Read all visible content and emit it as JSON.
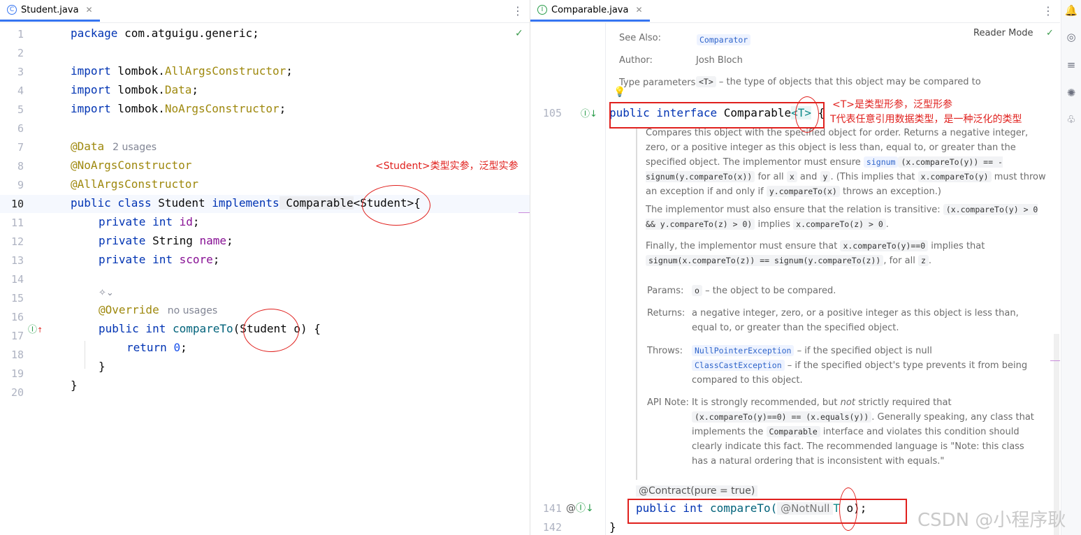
{
  "left_tab": {
    "label": "Student.java",
    "icon": "class-icon"
  },
  "right_tab": {
    "label": "Comparable.java",
    "icon": "interface-icon"
  },
  "left_gutter": [
    "1",
    "2",
    "3",
    "4",
    "5",
    "6",
    "7",
    "8",
    "9",
    "10",
    "11",
    "12",
    "13",
    "14",
    "15",
    "16",
    "17",
    "18",
    "19",
    "20"
  ],
  "left_code": {
    "l1": "package com.atguigu.generic;",
    "l3_kw": "import",
    "l3_a": " lombok.",
    "l3_b": "AllArgsConstructor",
    "l3_c": ";",
    "l4_kw": "import",
    "l4_a": " lombok.",
    "l4_b": "Data",
    "l4_c": ";",
    "l5_kw": "import",
    "l5_a": " lombok.",
    "l5_b": "NoArgsConstructor",
    "l5_c": ";",
    "l7": "@Data",
    "l7_hint": "2 usages",
    "l8": "@NoArgsConstructor",
    "l9": "@AllArgsConstructor",
    "l10_kw": "public class",
    "l10_a": " Student ",
    "l10_kw2": "implements",
    "l10_b": " Comparable",
    "l10_c": "<Student>{",
    "l11_kw": "private int",
    "l11_f": "id",
    "l11_c": ";",
    "l12_kw": "private",
    "l12_a": " String ",
    "l12_f": "name",
    "l12_c": ";",
    "l13_kw": "private int",
    "l13_f": "score",
    "l13_c": ";",
    "l15": "@Override",
    "l15_hint": "no usages",
    "l16_kw": "public int",
    "l16_m": "compareTo",
    "l16_a": "(Student o) {",
    "l17_kw": "return",
    "l17_n": "0",
    "l17_c": ";",
    "l18": "}",
    "l19": "}"
  },
  "left_note": "<Student>类型实参，泛型实参",
  "right_doc": {
    "reader_mode": "Reader Mode",
    "see_also_label": "See Also:",
    "see_also_value": "Comparator",
    "author_label": "Author:",
    "author_value": "Josh Bloch",
    "type_params_label": "Type parameters:",
    "type_params_chip": "<T>",
    "type_params_text": "– the type of objects that this object may be compared to",
    "line105": "105",
    "decl_kw": "public interface",
    "decl_name": " Comparable",
    "decl_tp": "<T>",
    "decl_end": " {",
    "p1": "Compares this object with the specified object for order. Returns a negative integer, zero, or a positive integer as this object is less than, equal to, or greater than the specified object.",
    "p2a": "The implementor must ensure",
    "p2_link": "signum",
    "p2_code": "(x.compareTo(y)) == -signum(y.compareTo(x))",
    "p2b": "for all",
    "p2_x": "x",
    "p2c": "and",
    "p2_y": "y",
    "p2d": ". (This implies that",
    "p2_code2": "x.compareTo(y)",
    "p2e": "must throw an exception if and only if",
    "p2_code3": "y.compareTo(x)",
    "p2f": "throws an exception.)",
    "p3a": "The implementor must also ensure that the relation is transitive:",
    "p3_code": "(x.compareTo(y) > 0 && y.compareTo(z) > 0)",
    "p3b": "implies",
    "p3_code2": "x.compareTo(z) > 0",
    "p3c": ".",
    "p4a": "Finally, the implementor must ensure that",
    "p4_code": "x.compareTo(y)==0",
    "p4b": "implies that",
    "p4_code2": "signum(x.compareTo(z)) == signum(y.compareTo(z))",
    "p4c": ", for all",
    "p4_z": "z",
    "p4d": ".",
    "params_label": "Params:",
    "params_chip": "o",
    "params_text": "– the object to be compared.",
    "returns_label": "Returns:",
    "returns_text": "a negative integer, zero, or a positive integer as this object is less than, equal to, or greater than the specified object.",
    "throws_label": "Throws:",
    "throws_1": "NullPointerException",
    "throws_1_text": "– if the specified object is null",
    "throws_2": "ClassCastException",
    "throws_2_text": "– if the specified object's type prevents it from being compared to this object.",
    "api_label": "API Note:",
    "api_a": "It is strongly recommended, but",
    "api_not": "not",
    "api_b": "strictly required that",
    "api_code": "(x.compareTo(y)==0) == (x.equals(y))",
    "api_c": ". Generally speaking, any class that implements the",
    "api_code2": "Comparable",
    "api_d": "interface and violates this condition should clearly indicate this fact. The recommended language is \"Note: this class has a natural ordering that is inconsistent with equals.\"",
    "contract": "@Contract(pure = true)",
    "line141": "141",
    "line142": "142",
    "m_kw": "public int",
    "m_name": " compareTo(",
    "m_ann": " @NotNull ",
    "m_tp": "T",
    "m_end": " o);",
    "close": "}"
  },
  "right_note_1": "<T>是类型形参，泛型形参",
  "right_note_2": "T代表任意引用数据类型，是一种泛化的类型",
  "watermark": "CSDN @小程序耿",
  "colors": {
    "keyword": "#0033b3",
    "annotation": "#9e880d",
    "field": "#871094",
    "annotation_red": "#e0201d"
  }
}
